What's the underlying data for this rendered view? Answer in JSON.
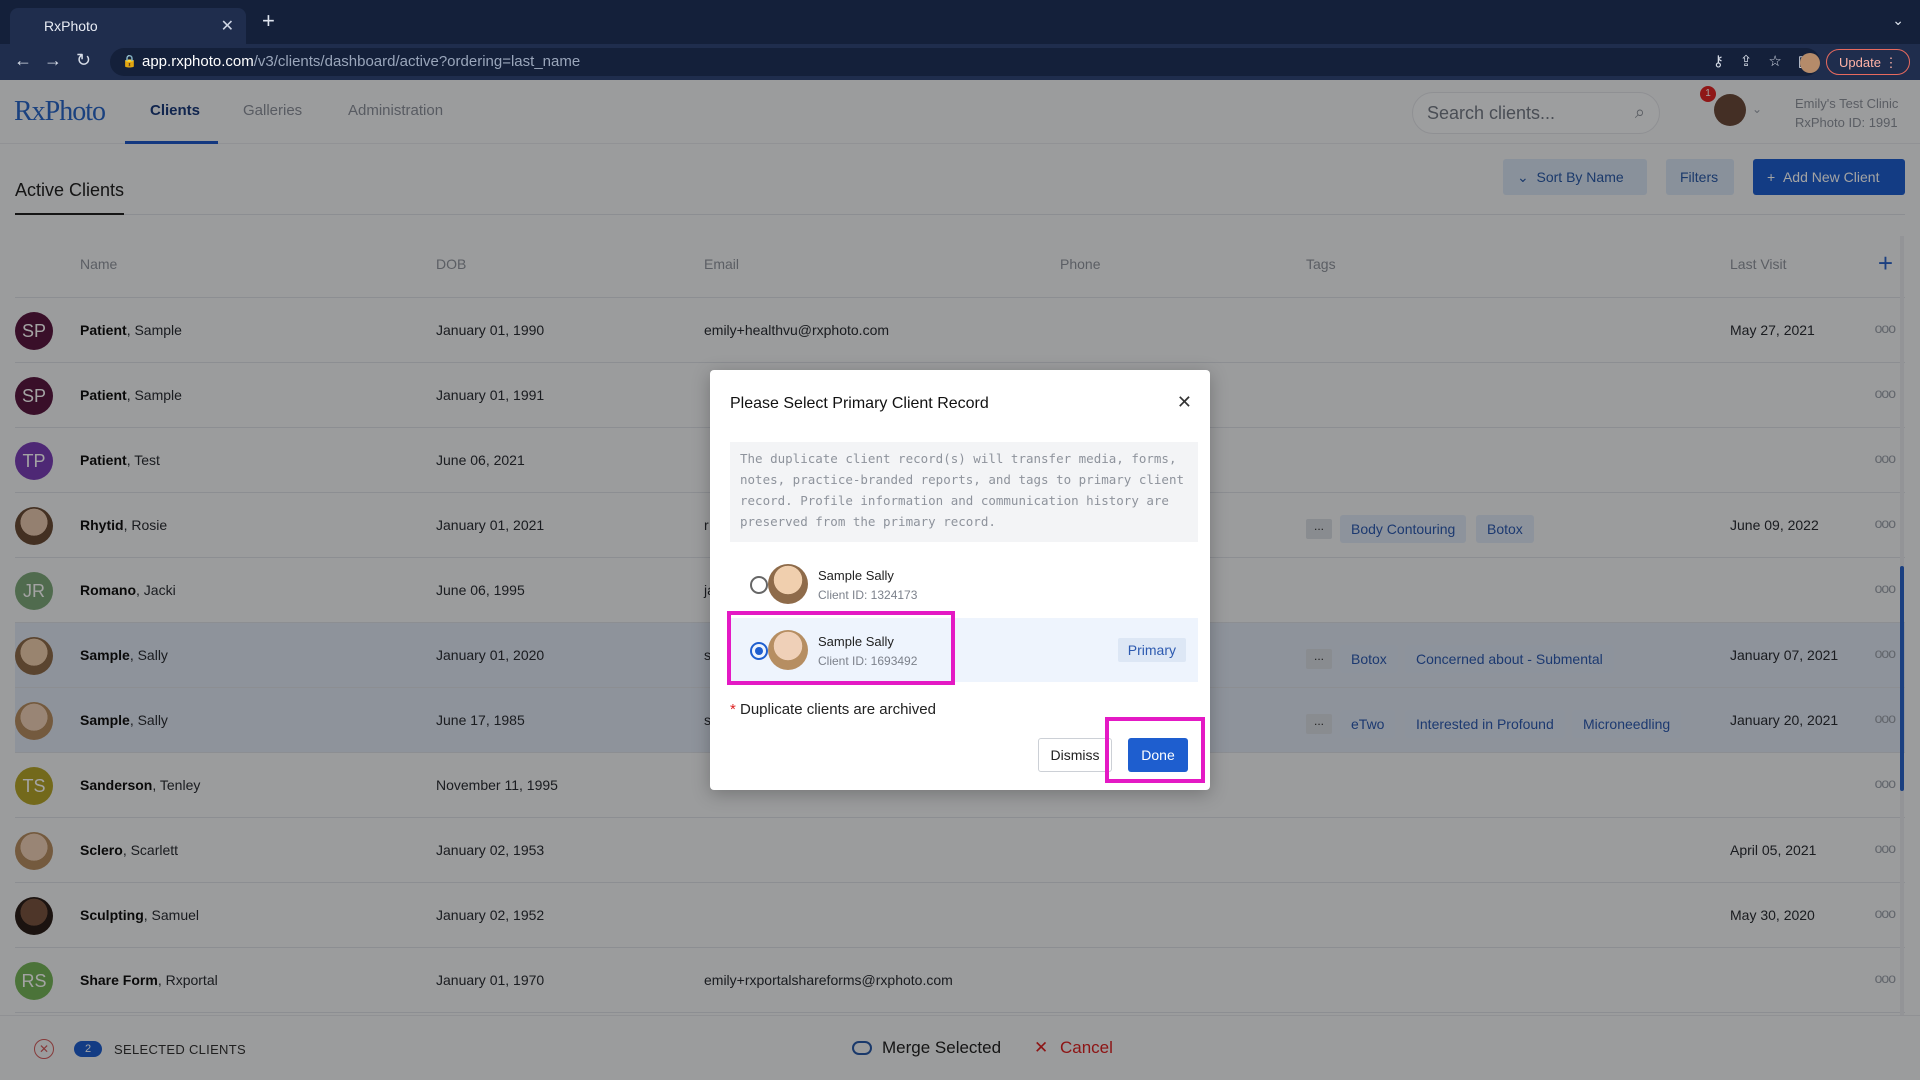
{
  "browser": {
    "tab_title": "RxPhoto",
    "tab_close": "✕",
    "new_tab": "+",
    "url_host": "app.rxphoto.com",
    "url_path": "/v3/clients/dashboard/active?ordering=last_name",
    "update_label": "Update"
  },
  "app": {
    "logo": "RxPhoto",
    "nav": [
      "Clients",
      "Galleries",
      "Administration"
    ],
    "search_placeholder": "Search clients...",
    "notifications": "1",
    "clinic_name": "Emily's Test Clinic",
    "clinic_id": "RxPhoto ID: 1991"
  },
  "page": {
    "title": "Active Clients",
    "sort_label": "Sort By Name",
    "filters_label": "Filters",
    "add_label": "Add New Client"
  },
  "table": {
    "headers": [
      "Name",
      "DOB",
      "Email",
      "Phone",
      "Tags",
      "Last Visit"
    ],
    "rows": [
      {
        "initials": "SP",
        "last": "Patient",
        "first": ", Sample",
        "dob": "January 01, 1990",
        "email": "emily+healthvu@rxphoto.com",
        "last_visit": "May 27, 2021",
        "tags": []
      },
      {
        "initials": "SP",
        "last": "Patient",
        "first": ", Sample",
        "dob": "January 01, 1991",
        "email": "",
        "last_visit": "",
        "tags": []
      },
      {
        "initials": "TP",
        "last": "Patient",
        "first": ", Test",
        "dob": "June 06, 2021",
        "email": "",
        "last_visit": "",
        "tags": []
      },
      {
        "initials": "",
        "last": "Rhytid",
        "first": ", Rosie",
        "dob": "January 01, 2021",
        "email": "r",
        "last_visit": "June 09, 2022",
        "tags": [
          "...",
          "Body Contouring",
          "Botox"
        ]
      },
      {
        "initials": "JR",
        "last": "Romano",
        "first": ", Jacki",
        "dob": "June 06, 1995",
        "email": "ja",
        "last_visit": "",
        "tags": []
      },
      {
        "initials": "",
        "last": "Sample",
        "first": ", Sally",
        "dob": "January 01, 2020",
        "email": "s",
        "last_visit": "January 07, 2021",
        "tags": [
          "...",
          "Botox",
          "Concerned about - Submental"
        ]
      },
      {
        "initials": "",
        "last": "Sample",
        "first": ", Sally",
        "dob": "June 17, 1985",
        "email": "s",
        "last_visit": "January 20, 2021",
        "tags": [
          "...",
          "eTwo",
          "Interested in Profound",
          "Microneedling"
        ]
      },
      {
        "initials": "TS",
        "last": "Sanderson",
        "first": ", Tenley",
        "dob": "November 11, 1995",
        "email": "",
        "last_visit": "",
        "tags": []
      },
      {
        "initials": "",
        "last": "Sclero",
        "first": ", Scarlett",
        "dob": "January 02, 1953",
        "email": "",
        "last_visit": "April 05, 2021",
        "tags": []
      },
      {
        "initials": "",
        "last": "Sculpting",
        "first": ", Samuel",
        "dob": "January 02, 1952",
        "email": "",
        "last_visit": "May 30, 2020",
        "tags": []
      },
      {
        "initials": "RS",
        "last": "Share Form",
        "first": ", Rxportal",
        "dob": "January 01, 1970",
        "email": "emily+rxportalshareforms@rxphoto.com",
        "last_visit": "",
        "tags": []
      }
    ],
    "kebab": "ooo"
  },
  "bottom_bar": {
    "count": "2",
    "label": "SELECTED CLIENTS",
    "merge_label": "Merge Selected",
    "cancel_label": "Cancel"
  },
  "modal": {
    "title": "Please Select Primary Client Record",
    "close": "✕",
    "description": "The duplicate client record(s) will transfer media, forms, notes, practice-branded reports, and tags to primary client record. Profile information and communication history are preserved from the primary record.",
    "choices": [
      {
        "name": "Sample Sally",
        "client_id": "Client ID: 1324173"
      },
      {
        "name": "Sample Sally",
        "client_id": "Client ID: 1693492",
        "badge": "Primary"
      }
    ],
    "note_star": "*",
    "note": " Duplicate clients are archived",
    "dismiss_label": "Dismiss",
    "done_label": "Done"
  },
  "colors": {
    "accent": "#1e5ecf",
    "highlight": "#e419c4",
    "danger": "#dd2222"
  }
}
